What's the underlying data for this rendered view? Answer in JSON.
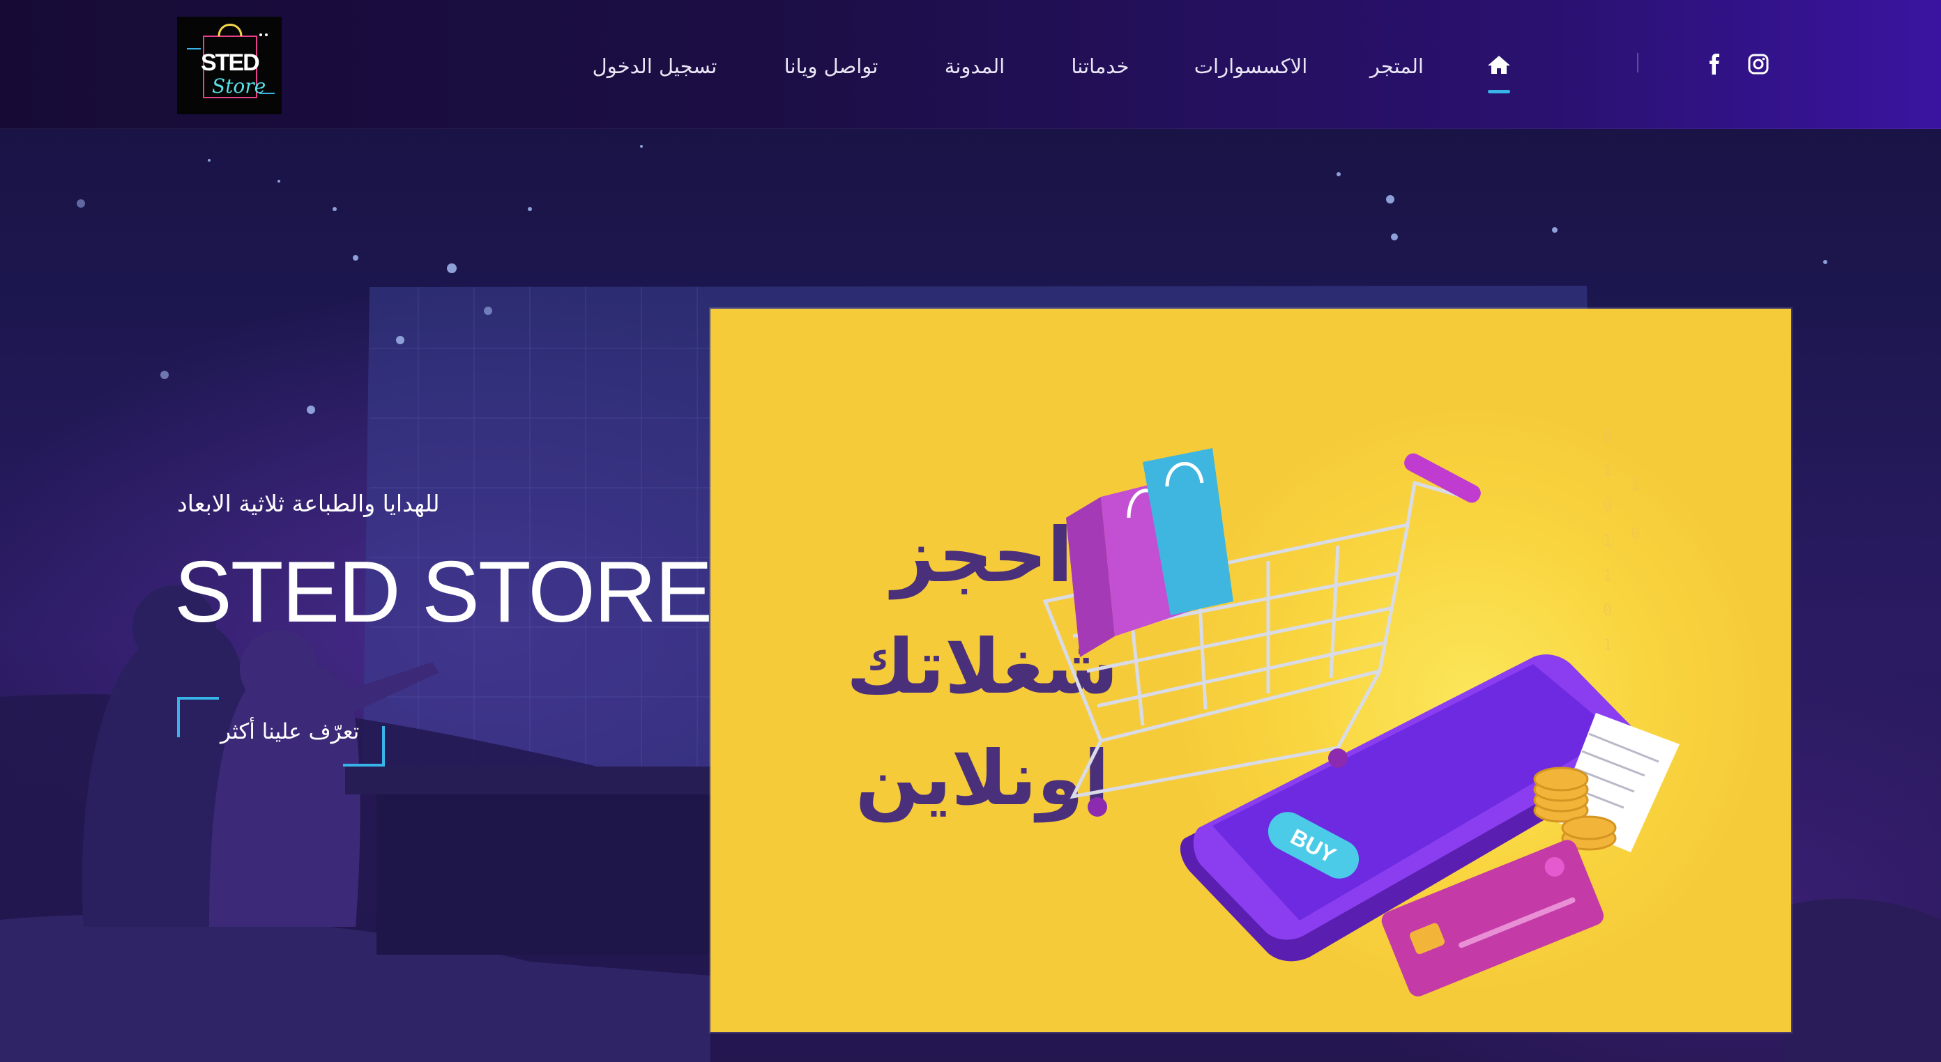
{
  "colors": {
    "accent": "#37b4e8",
    "header_bg_start": "#170b36",
    "header_bg_end": "#3a14a0",
    "banner_bg": "#f9d53f",
    "banner_text": "#4a2f7a"
  },
  "logo": {
    "line1": "STED",
    "line2": "Store"
  },
  "nav": {
    "home_icon": "home-icon",
    "items": [
      {
        "label": "المتجر"
      },
      {
        "label": "الاكسسوارات"
      },
      {
        "label": "خدماتنا"
      },
      {
        "label": "المدونة"
      },
      {
        "label": "تواصل ويانا"
      },
      {
        "label": "تسجيل الدخول"
      }
    ],
    "social": [
      {
        "icon": "facebook-icon"
      },
      {
        "icon": "instagram-icon"
      }
    ]
  },
  "hero": {
    "tagline": "للهدايا والطباعة ثلاثية الابعاد",
    "title": "STED STORE",
    "cta_label": "تعرّف علينا أكثر"
  },
  "banner": {
    "lines": [
      "احجز",
      "شغلاتك",
      "اونلاين"
    ],
    "phone_button": "BUY"
  }
}
